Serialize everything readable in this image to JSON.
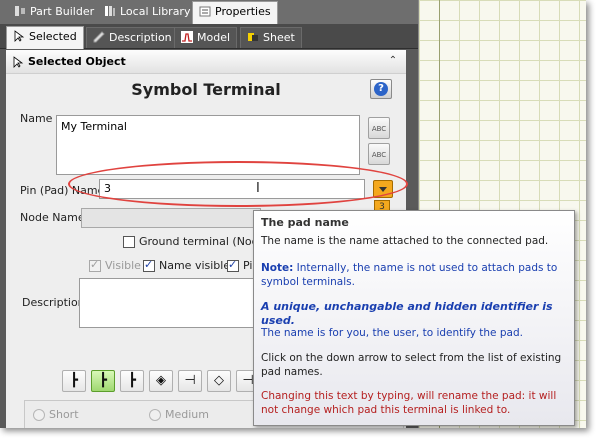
{
  "doc_tabs": [
    {
      "label": "Part Builder",
      "icon": "part-builder-icon"
    },
    {
      "label": "Local Library",
      "icon": "library-icon"
    },
    {
      "label": "Properties",
      "icon": "properties-icon"
    }
  ],
  "sub_tabs": [
    {
      "label": "Selected",
      "icon": "cursor-icon"
    },
    {
      "label": "Description",
      "icon": "description-icon"
    },
    {
      "label": "Model",
      "icon": "model-icon"
    },
    {
      "label": "Sheet",
      "icon": "sheet-icon"
    }
  ],
  "section": {
    "title": "Selected Object",
    "collapse_icon": "chevron-up-double-icon"
  },
  "object_title": "Symbol Terminal",
  "form": {
    "name_label": "Name",
    "name_value": "My Terminal",
    "pin_label": "Pin (Pad) Name",
    "pin_value": "3",
    "pin_badge": "3",
    "node_label": "Node Name",
    "ground_label": "Ground terminal (Node O",
    "visible_label": "Visible",
    "name_visible_label": "Name visible",
    "pin_cut_label": "Pi",
    "description_label": "Description",
    "radio_short": "Short",
    "radio_medium": "Medium",
    "spell_btn_1": "ABC",
    "spell_btn_2": "ABC"
  },
  "symbols": [
    "┣",
    "┣",
    "┣",
    "◈",
    "⊣",
    "◇",
    "⊣"
  ],
  "tooltip": {
    "title": "The pad name",
    "line1": "The name is the name attached to the connected pad.",
    "note_label": "Note:",
    "note_text": " Internally, the name is not used to attach pads to symbol terminals.",
    "unique": "A unique, unchangable and hidden identifier is used.",
    "for_you": "The name is for you, the user, to identify the pad.",
    "click": " Click on the down arrow to select from the list of existing pad names.",
    "changing": "Changing this text by typing, will rename the pad: it will not change which pad this terminal is linked to."
  },
  "colors": {
    "annotation_red": "#e0433f",
    "dropdown_orange": "#f4a81e",
    "note_blue": "#1a3fb0",
    "warning_red": "#b52020"
  }
}
